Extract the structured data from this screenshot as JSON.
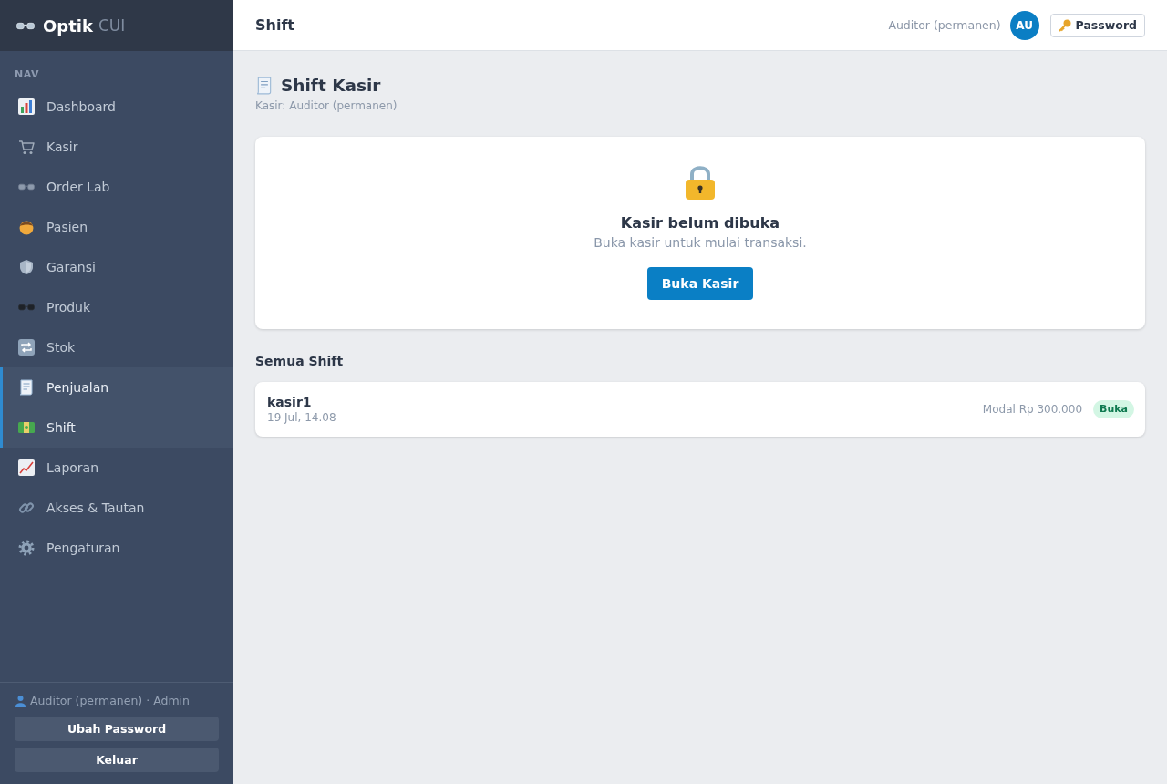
{
  "sidebar": {
    "brand": {
      "name": "Optik",
      "suffix": "CUI"
    },
    "section_label": "NAV",
    "items": [
      {
        "label": "Dashboard",
        "selected": false
      },
      {
        "label": "Kasir",
        "selected": false
      },
      {
        "label": "Order Lab",
        "selected": false
      },
      {
        "label": "Pasien",
        "selected": false
      },
      {
        "label": "Garansi",
        "selected": false
      },
      {
        "label": "Produk",
        "selected": false
      },
      {
        "label": "Stok",
        "selected": false
      },
      {
        "label": "Penjualan",
        "selected": true
      },
      {
        "label": "Shift",
        "selected": true
      },
      {
        "label": "Laporan",
        "selected": false
      },
      {
        "label": "Akses & Tautan",
        "selected": false
      },
      {
        "label": "Pengaturan",
        "selected": false
      }
    ],
    "user": "Auditor (permanen) · Admin",
    "buttons": [
      "Ubah Password",
      "Keluar"
    ]
  },
  "header": {
    "title": "Shift",
    "user_name": "Auditor (permanen)",
    "avatar_initials": "AU",
    "password_button": "Password"
  },
  "page": {
    "title": "Shift Kasir",
    "subtitle": "Kasir: Auditor (permanen)"
  },
  "closed_card": {
    "title": "Kasir belum dibuka",
    "message": "Buka kasir untuk mulai transaksi.",
    "button": "Buka Kasir"
  },
  "shifts_section": {
    "title": "Semua Shift",
    "rows": [
      {
        "cashier": "kasir1",
        "time": "19 Jul, 14.08",
        "capital": "Modal Rp 300.000",
        "status": "Buka"
      }
    ]
  }
}
